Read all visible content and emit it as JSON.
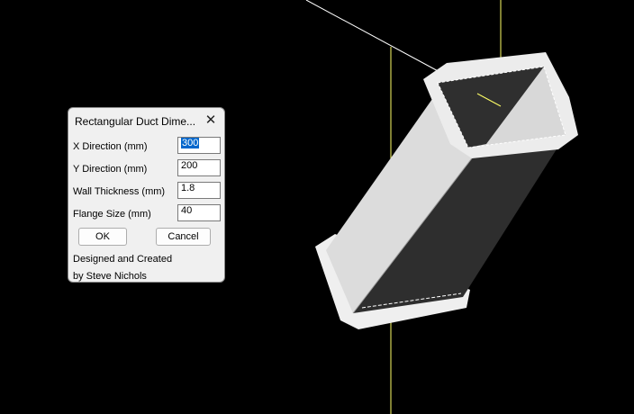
{
  "dialog": {
    "title": "Rectangular Duct Dime...",
    "fields": [
      {
        "label": "X Direction (mm)",
        "value": "300"
      },
      {
        "label": "Y Direction (mm)",
        "value": "200"
      },
      {
        "label": "Wall Thickness (mm)",
        "value": "1.8"
      },
      {
        "label": "Flange Size (mm)",
        "value": "40"
      }
    ],
    "ok_label": "OK",
    "cancel_label": "Cancel",
    "credit_line1": "Designed and Created",
    "credit_line2": "by Steve Nichols"
  },
  "colors": {
    "background": "#000000",
    "axis_yellow": "#ffff66",
    "duct_light": "#dadada",
    "duct_dark": "#303030",
    "flange": "#f0f0f0",
    "selection": "#0066cc"
  }
}
